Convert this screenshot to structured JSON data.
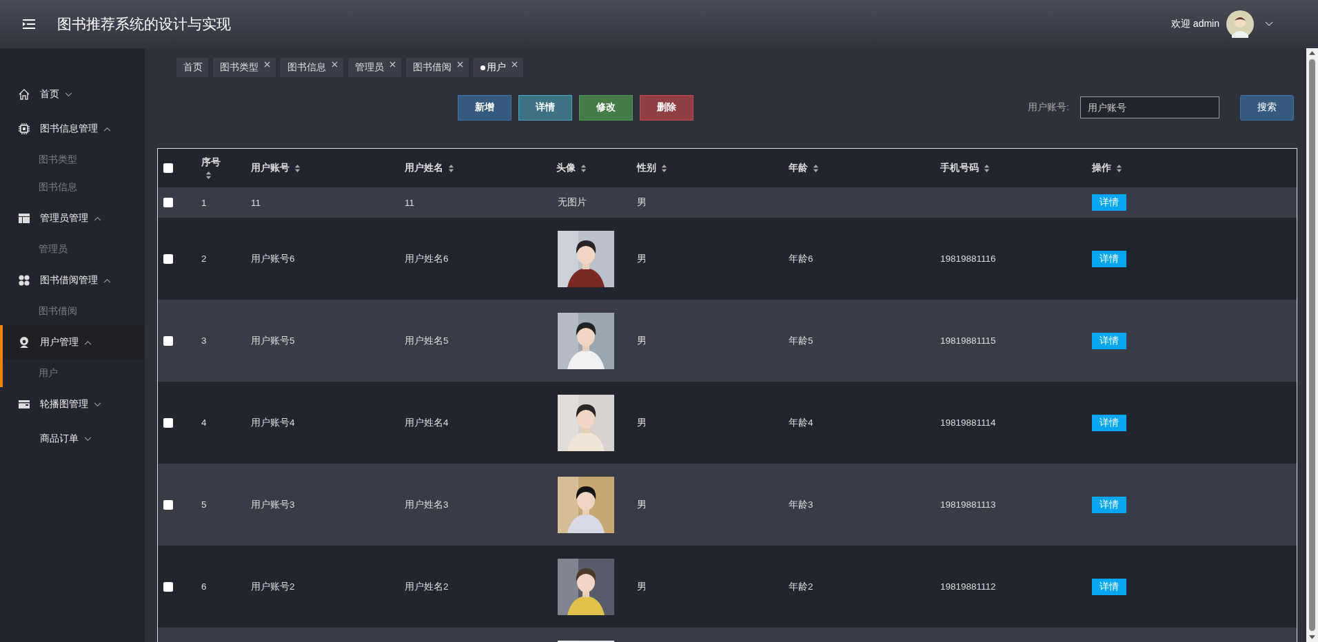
{
  "header": {
    "title": "图书推荐系统的设计与实现",
    "welcome": "欢迎 admin"
  },
  "sidebar": {
    "items": [
      {
        "label": "首页",
        "expanded": false,
        "selected": false
      },
      {
        "label": "图书信息管理",
        "expanded": true,
        "selected": false,
        "children": [
          {
            "label": "图书类型",
            "selected": false
          },
          {
            "label": "图书信息",
            "selected": false
          }
        ]
      },
      {
        "label": "管理员管理",
        "expanded": true,
        "selected": false,
        "children": [
          {
            "label": "管理员",
            "selected": false
          }
        ]
      },
      {
        "label": "图书借阅管理",
        "expanded": true,
        "selected": false,
        "children": [
          {
            "label": "图书借阅",
            "selected": false
          }
        ]
      },
      {
        "label": "用户管理",
        "expanded": true,
        "selected": true,
        "children": [
          {
            "label": "用户",
            "selected": true
          }
        ]
      },
      {
        "label": "轮播图管理",
        "expanded": false,
        "selected": false
      },
      {
        "label": "商品订单",
        "expanded": false,
        "selected": false
      }
    ]
  },
  "tabs": [
    {
      "label": "首页",
      "closable": false,
      "selected": false
    },
    {
      "label": "图书类型",
      "closable": true,
      "selected": false
    },
    {
      "label": "图书信息",
      "closable": true,
      "selected": false
    },
    {
      "label": "管理员",
      "closable": true,
      "selected": false
    },
    {
      "label": "图书借阅",
      "closable": true,
      "selected": false
    },
    {
      "label": "用户",
      "closable": true,
      "selected": true
    }
  ],
  "actions": [
    {
      "label": "新增",
      "kind": "add"
    },
    {
      "label": "详情",
      "kind": "detail"
    },
    {
      "label": "修改",
      "kind": "edit"
    },
    {
      "label": "删除",
      "kind": "delete"
    }
  ],
  "search": {
    "label": "用户账号:",
    "placeholder": "用户账号",
    "button": "搜索"
  },
  "table": {
    "all_checked": false,
    "columns": [
      "序号",
      "用户账号",
      "用户姓名",
      "头像",
      "性别",
      "年龄",
      "手机号码",
      "操作"
    ],
    "rows": [
      {
        "checked": false,
        "index": "1",
        "account": "11",
        "name": "11",
        "avatar": {
          "kind": "text",
          "text": "无图片"
        },
        "gender": "男",
        "action": "详情"
      },
      {
        "checked": false,
        "index": "2",
        "account": "用户账号6",
        "name": "用户姓名6",
        "avatar": {
          "kind": "picture"
        },
        "gender": "男",
        "age": "年龄6",
        "phone": "19819881116",
        "action": "详情"
      },
      {
        "checked": false,
        "index": "3",
        "account": "用户账号5",
        "name": "用户姓名5",
        "avatar": {
          "kind": "picture"
        },
        "gender": "男",
        "age": "年龄5",
        "phone": "19819881115",
        "action": "详情"
      },
      {
        "checked": false,
        "index": "4",
        "account": "用户账号4",
        "name": "用户姓名4",
        "avatar": {
          "kind": "picture"
        },
        "gender": "男",
        "age": "年龄4",
        "phone": "19819881114",
        "action": "详情"
      },
      {
        "checked": false,
        "index": "5",
        "account": "用户账号3",
        "name": "用户姓名3",
        "avatar": {
          "kind": "picture"
        },
        "gender": "男",
        "age": "年龄3",
        "phone": "19819881113",
        "action": "详情"
      },
      {
        "checked": false,
        "index": "6",
        "account": "用户账号2",
        "name": "用户姓名2",
        "avatar": {
          "kind": "picture"
        },
        "gender": "男",
        "age": "年龄2",
        "phone": "19819881112",
        "action": "详情"
      },
      {
        "avatar": {
          "kind": "picture"
        }
      }
    ]
  }
}
